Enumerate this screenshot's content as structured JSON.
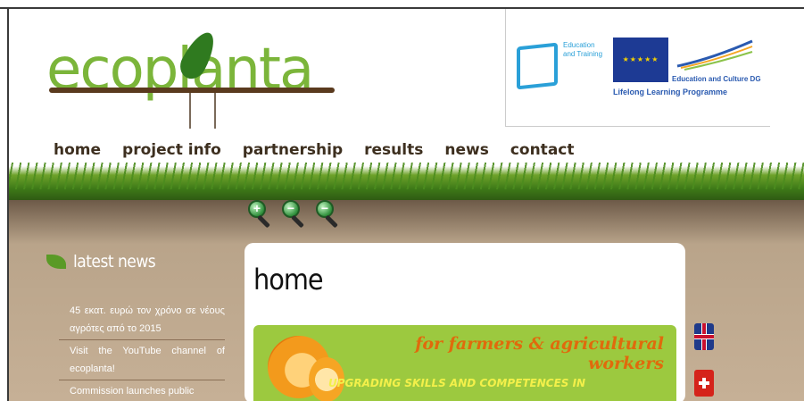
{
  "header": {
    "logo_text": "ecoplanta",
    "eu": {
      "edu_label": "Education and Training",
      "culture_label": "Education and Culture DG",
      "llp_label": "Lifelong Learning Programme"
    }
  },
  "nav": {
    "items": [
      "home",
      "project info",
      "partnership",
      "results",
      "news",
      "contact"
    ]
  },
  "zoom": {
    "buttons": [
      {
        "icon": "zoom-in-icon",
        "symbol": "+"
      },
      {
        "icon": "zoom-out-icon",
        "symbol": "−"
      },
      {
        "icon": "zoom-reset-icon",
        "symbol": "−"
      }
    ]
  },
  "sidebar": {
    "title": "latest news",
    "items": [
      "45 εκατ. ευρώ τον χρόνο σε νέους αγρότες από το 2015",
      "Visit the YouTube channel of ecoplanta!",
      "Commission launches public"
    ]
  },
  "main": {
    "title": "home",
    "banner": {
      "line1": "for farmers & agricultural",
      "line2": "workers",
      "line3": "UPGRADING SKILLS AND COMPETENCES IN"
    }
  },
  "languages": [
    {
      "icon": "uk-flag-icon"
    },
    {
      "icon": "swiss-flag-icon"
    }
  ],
  "colors": {
    "brand_green": "#7bb53a",
    "soil": "#c6b096",
    "banner_green": "#9cc93f",
    "banner_orange": "#e06a0c",
    "banner_yellow": "#f3f04a"
  }
}
